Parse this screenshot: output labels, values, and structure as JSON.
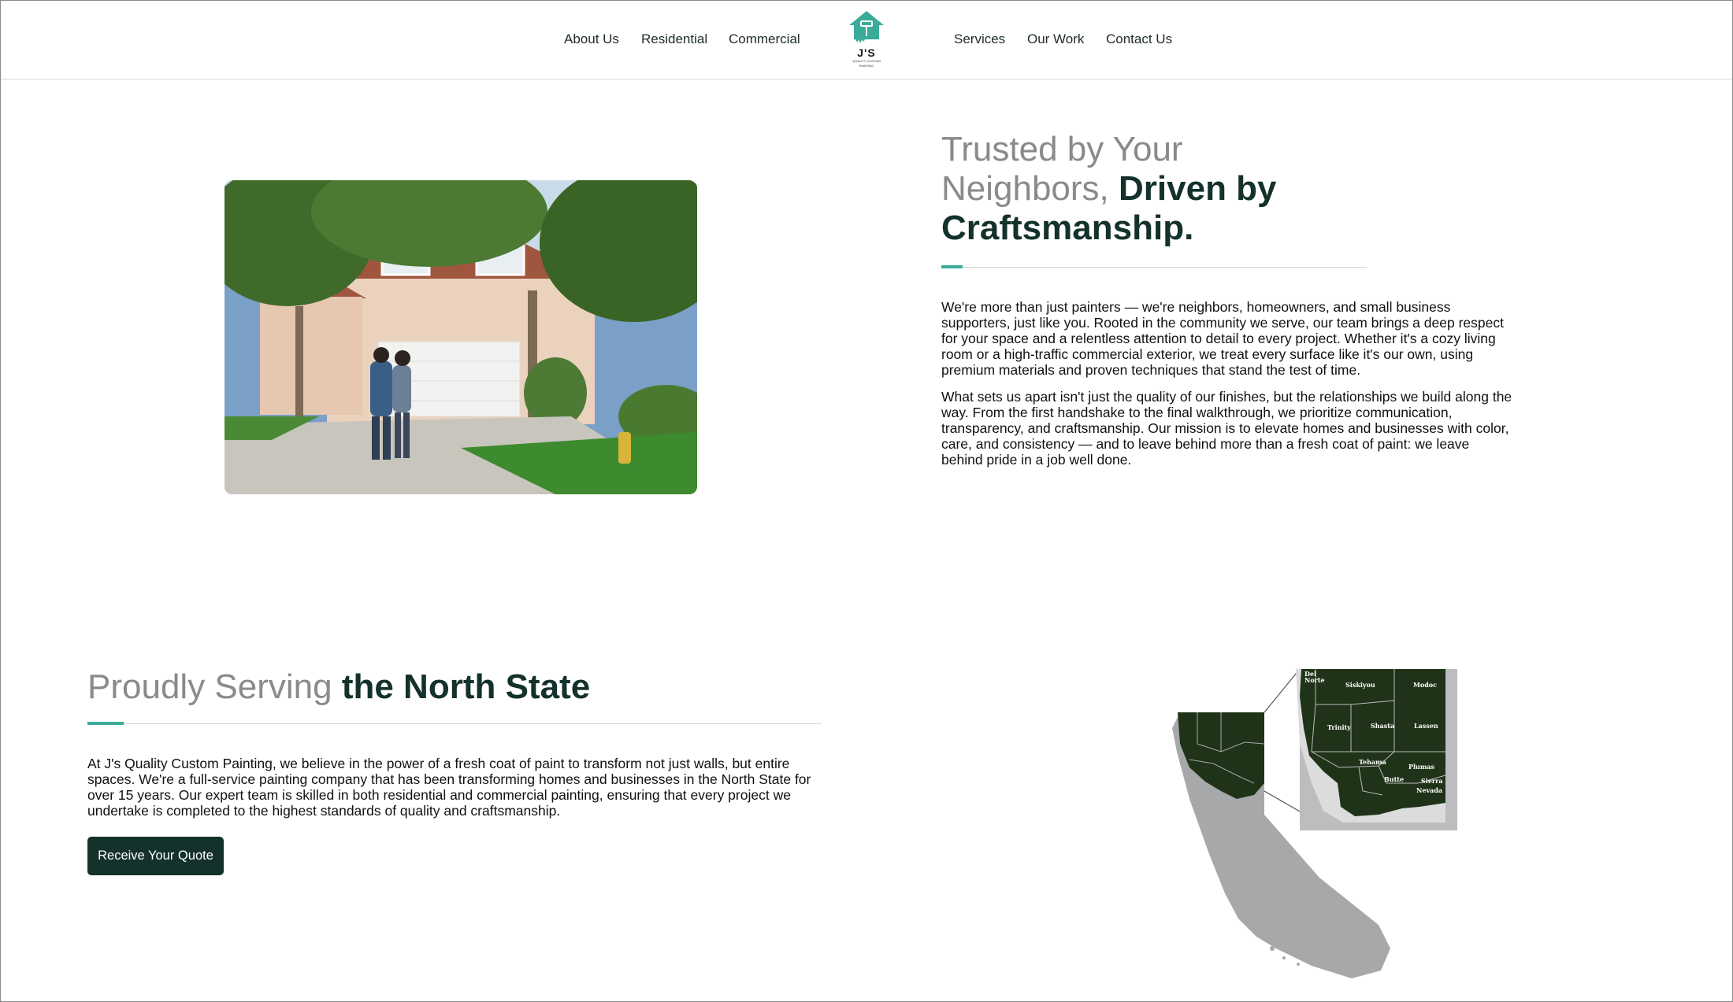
{
  "nav": {
    "left": [
      "About Us",
      "Residential",
      "Commercial"
    ],
    "right": [
      "Services",
      "Our Work",
      "Contact Us"
    ],
    "logo": {
      "initials": "J'S",
      "line1": "QUALITY CUSTOM",
      "line2": "PAINTING"
    }
  },
  "trusted": {
    "title_light": "Trusted by Your Neighbors, ",
    "title_bold": "Driven by Craftsmanship.",
    "p1": "We're more than just painters — we're neighbors, homeowners, and small business supporters, just like you. Rooted in the community we serve, our team brings a deep respect for your space and a relentless attention to detail to every project. Whether it's a cozy living room or a high-traffic commercial exterior, we treat every surface like it's our own, using premium materials and proven techniques that stand the test of time.",
    "p2": "What sets us apart isn't just the quality of our finishes, but the relationships we build along the way. From the first handshake to the final walkthrough, we prioritize communication, transparency, and craftsmanship. Our mission is to elevate homes and businesses with color, care, and consistency — and to leave behind more than a fresh coat of paint: we leave behind pride in a job well done."
  },
  "serving": {
    "title_light": "Proudly Serving ",
    "title_bold": "the North State",
    "body": "At J's Quality Custom Painting, we believe in the power of a fresh coat of paint to transform not just walls, but entire spaces. We're a full-service painting company that has been transforming homes and businesses in the North State for over 15 years. Our expert team is skilled in both residential and commercial painting, ensuring that every project we undertake is completed to the highest standards of quality and craftsmanship.",
    "cta": "Receive Your Quote"
  },
  "map": {
    "counties": [
      "Del Norte",
      "Siskiyou",
      "Modoc",
      "Trinity",
      "Shasta",
      "Lassen",
      "Tehama",
      "Plumas",
      "Butte",
      "Sierra",
      "Nevada"
    ]
  },
  "colors": {
    "accent": "#3aab99",
    "dark_green": "#14312b",
    "map_green": "#1f3318",
    "map_gray": "#a7a8aa"
  }
}
